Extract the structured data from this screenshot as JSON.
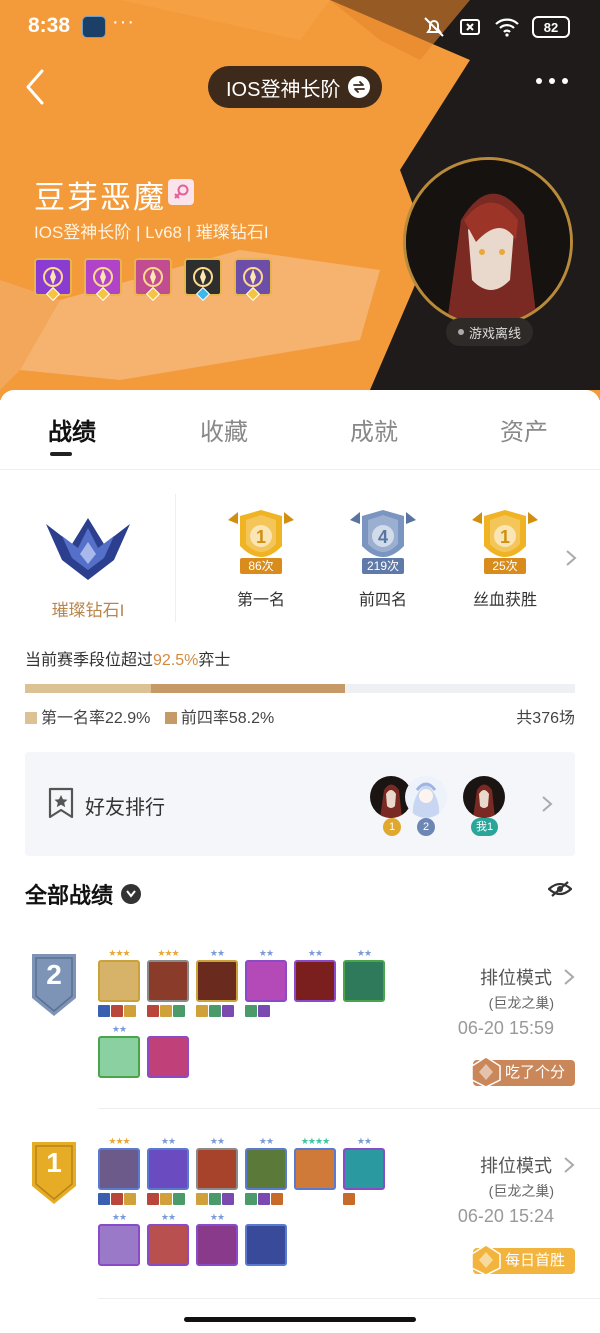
{
  "status_bar": {
    "time": "8:38",
    "more_dots": "···",
    "battery": "82"
  },
  "header": {
    "mode_selector": "IOS登神长阶",
    "player_name": "豆芽恶魔",
    "player_meta": "IOS登神长阶 | Lv68 | 璀璨钻石I",
    "online_status": "游戏离线",
    "badges": [
      "#8a3bd1",
      "#b143c9",
      "#c14c8f",
      "#2e2e2e",
      "#6c4ea8"
    ],
    "colors": {
      "accent": "#f39a3a",
      "dark": "#1e1b1a"
    }
  },
  "tabs": [
    {
      "label": "战绩",
      "active": true
    },
    {
      "label": "收藏",
      "active": false
    },
    {
      "label": "成就",
      "active": false
    },
    {
      "label": "资产",
      "active": false
    }
  ],
  "rank": {
    "name": "璀璨钻石I"
  },
  "placements": [
    {
      "num": "1",
      "count": "86次",
      "label": "第一名",
      "color": "#f0b323"
    },
    {
      "num": "4",
      "count": "219次",
      "label": "前四名",
      "color": "#7a95c0"
    },
    {
      "num": "1",
      "count": "25次",
      "label": "丝血获胜",
      "color": "#f0b323"
    }
  ],
  "season": {
    "prefix": "当前赛季段位超过",
    "percent": "92.5%",
    "suffix": "弈士",
    "first_rate_label": "第一名率22.9%",
    "top4_rate_label": "前四率58.2%",
    "first_rate": 0.229,
    "top4_rate": 0.582,
    "total": "共376场"
  },
  "friends": {
    "title": "好友排行",
    "ranks": [
      "1",
      "2",
      "我1"
    ]
  },
  "matches_title": "全部战绩",
  "matches": [
    {
      "placement": "2",
      "mode": "排位模式",
      "map": "(巨龙之巢)",
      "time": "06-20 15:59",
      "tag": "吃了个分",
      "tag_color": "#c9875a"
    },
    {
      "placement": "1",
      "mode": "排位模式",
      "map": "(巨龙之巢)",
      "time": "06-20 15:24",
      "tag": "每日首胜",
      "tag_color": "#f2b43c"
    }
  ]
}
